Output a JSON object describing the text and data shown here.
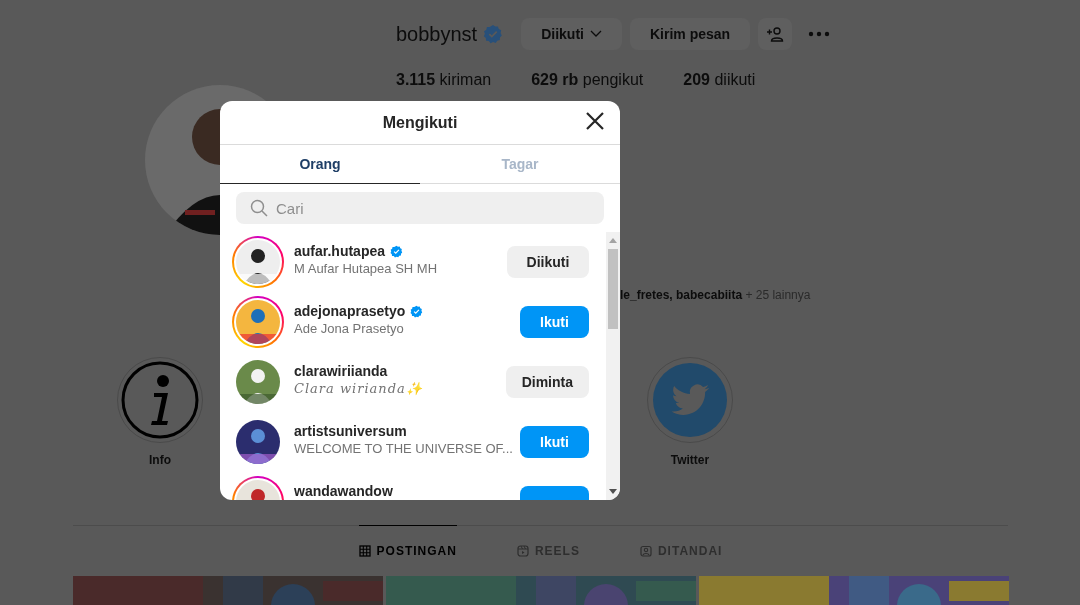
{
  "profile": {
    "username": "bobbynst",
    "verified": true,
    "buttons": [
      {
        "kind": "following",
        "label": "Diikuti"
      },
      {
        "kind": "message",
        "label": "Kirim pesan"
      },
      {
        "kind": "add-person"
      },
      {
        "kind": "more"
      }
    ],
    "stats": [
      {
        "value": "3.115",
        "label": "kiriman"
      },
      {
        "value": "629 rb",
        "label": "pengikut"
      },
      {
        "value": "209",
        "label": "diikuti"
      }
    ],
    "followed_by": {
      "names": "le_fretes, babecabiita",
      "more": "+ 25 lainnya"
    }
  },
  "highlights": [
    {
      "kind": "info",
      "label": "Info"
    },
    {
      "kind": "twitter",
      "label": "Twitter"
    }
  ],
  "content_tabs": [
    {
      "kind": "grid",
      "label": "POSTINGAN",
      "selected": true
    },
    {
      "kind": "reels",
      "label": "REELS",
      "selected": false
    },
    {
      "kind": "tagged",
      "label": "DITANDAI",
      "selected": false
    }
  ],
  "dialog": {
    "title": "Mengikuti",
    "tabs": [
      {
        "label": "Orang",
        "selected": true
      },
      {
        "label": "Tagar",
        "selected": false
      }
    ],
    "search": {
      "placeholder": "Cari"
    },
    "users": [
      {
        "username": "aufar.hutapea",
        "verified": true,
        "story_ring": true,
        "name": "M Aufar Hutapea SH MH",
        "kind": "plain",
        "button": {
          "kind": "following",
          "label": "Diikuti"
        }
      },
      {
        "username": "adejonaprasetyo",
        "verified": true,
        "story_ring": true,
        "name": "Ade Jona Prasetyo",
        "kind": "plain",
        "button": {
          "kind": "follow",
          "label": "Ikuti"
        }
      },
      {
        "username": "clarawiriianda",
        "verified": false,
        "story_ring": false,
        "name": "Clara wirianda✨",
        "kind": "script",
        "button": {
          "kind": "requested",
          "label": "Diminta"
        }
      },
      {
        "username": "artistsuniversum",
        "verified": false,
        "story_ring": false,
        "name": "WELCOME TO THE UNIVERSE OF...",
        "kind": "plain",
        "button": {
          "kind": "follow",
          "label": "Ikuti"
        }
      },
      {
        "username": "wandawandow",
        "verified": false,
        "story_ring": true,
        "button": {
          "kind": "follow"
        }
      }
    ]
  }
}
